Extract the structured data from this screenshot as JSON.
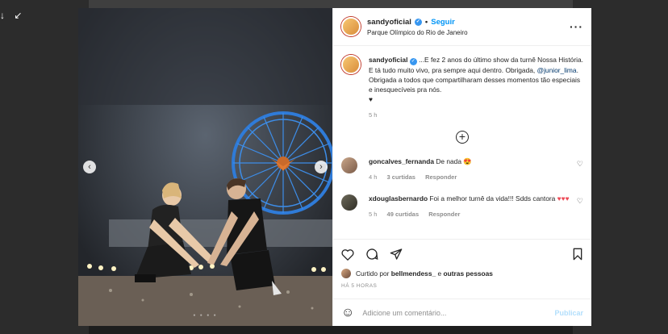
{
  "header": {
    "username": "sandyoficial",
    "separator": "•",
    "follow_label": "Seguir",
    "location": "Parque Olímpico do Rio de Janeiro"
  },
  "caption": {
    "username": "sandyoficial",
    "text_1": "...E fez 2 anos do último show da turnê Nossa História. E tá tudo muito vivo, pra sempre aqui dentro. Obrigada, ",
    "mention": "@junior_lima",
    "text_2": ". Obrigada a todos que compartilharam desses momentos tão especiais e inesquecíveis pra nós.",
    "heart": "♥",
    "time": "5 h"
  },
  "comments": [
    {
      "username": "goncalves_fernanda",
      "text": "De nada",
      "emoji": "😍",
      "time": "4 h",
      "likes": "3 curtidas",
      "reply_label": "Responder"
    },
    {
      "username": "xdouglasbernardo",
      "text": "Foi a melhor turnê da vida!!! Sdds cantora",
      "emoji": "♥♥♥",
      "time": "5 h",
      "likes": "49 curtidas",
      "reply_label": "Responder"
    }
  ],
  "likes_line": {
    "prefix": "Curtido por",
    "user": "bellmendess_",
    "connector": "e",
    "others": "outras pessoas"
  },
  "post_time": "HÁ 5 HORAS",
  "add_comment": {
    "placeholder": "Adicione um comentário...",
    "post_label": "Publicar"
  },
  "corner_glyphs": "↓ ↙",
  "colors": {
    "accent": "#0095f6",
    "heart_red": "#ed4956"
  }
}
